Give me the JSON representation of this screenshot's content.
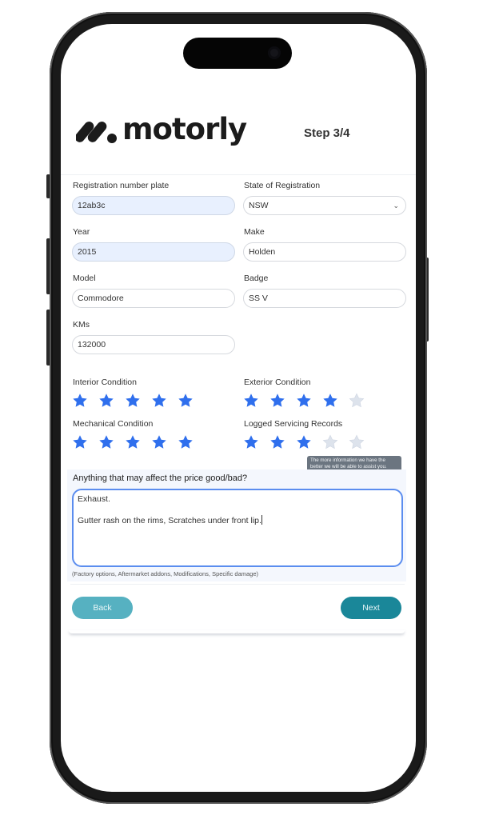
{
  "brand": {
    "name": "motorly",
    "logo_icon": "motorly-m-logo-icon"
  },
  "header": {
    "step": "Step 3/4"
  },
  "form": {
    "registration": {
      "label": "Registration number plate",
      "value": "12ab3c"
    },
    "state": {
      "label": "State of Registration",
      "value": "NSW",
      "icon": "chevron-down-icon"
    },
    "year": {
      "label": "Year",
      "value": "2015"
    },
    "make": {
      "label": "Make",
      "value": "Holden"
    },
    "model": {
      "label": "Model",
      "value": "Commodore"
    },
    "badge": {
      "label": "Badge",
      "value": "SS V"
    },
    "kms": {
      "label": "KMs",
      "value": "132000"
    }
  },
  "ratings": {
    "max": 5,
    "active_color": "#2f6fed",
    "inactive_color": "#dde3ec",
    "interior": {
      "label": "Interior Condition",
      "value": 5
    },
    "exterior": {
      "label": "Exterior Condition",
      "value": 4
    },
    "mechanical": {
      "label": "Mechanical Condition",
      "value": 5
    },
    "servicing": {
      "label": "Logged Servicing Records",
      "value": 3
    }
  },
  "tooltip": {
    "text": "The more information we have the better we will be able to assist you."
  },
  "notes": {
    "label": "Anything that may affect the price good/bad?",
    "value": "Exhaust.\n\nGutter rash on the rims, Scratches under front lip.",
    "hint": "(Factory options, Aftermarket addons, Modifications, Specific damage)"
  },
  "actions": {
    "back_label": "Back",
    "next_label": "Next",
    "back_color": "#56b1c1",
    "next_color": "#1a8799"
  }
}
